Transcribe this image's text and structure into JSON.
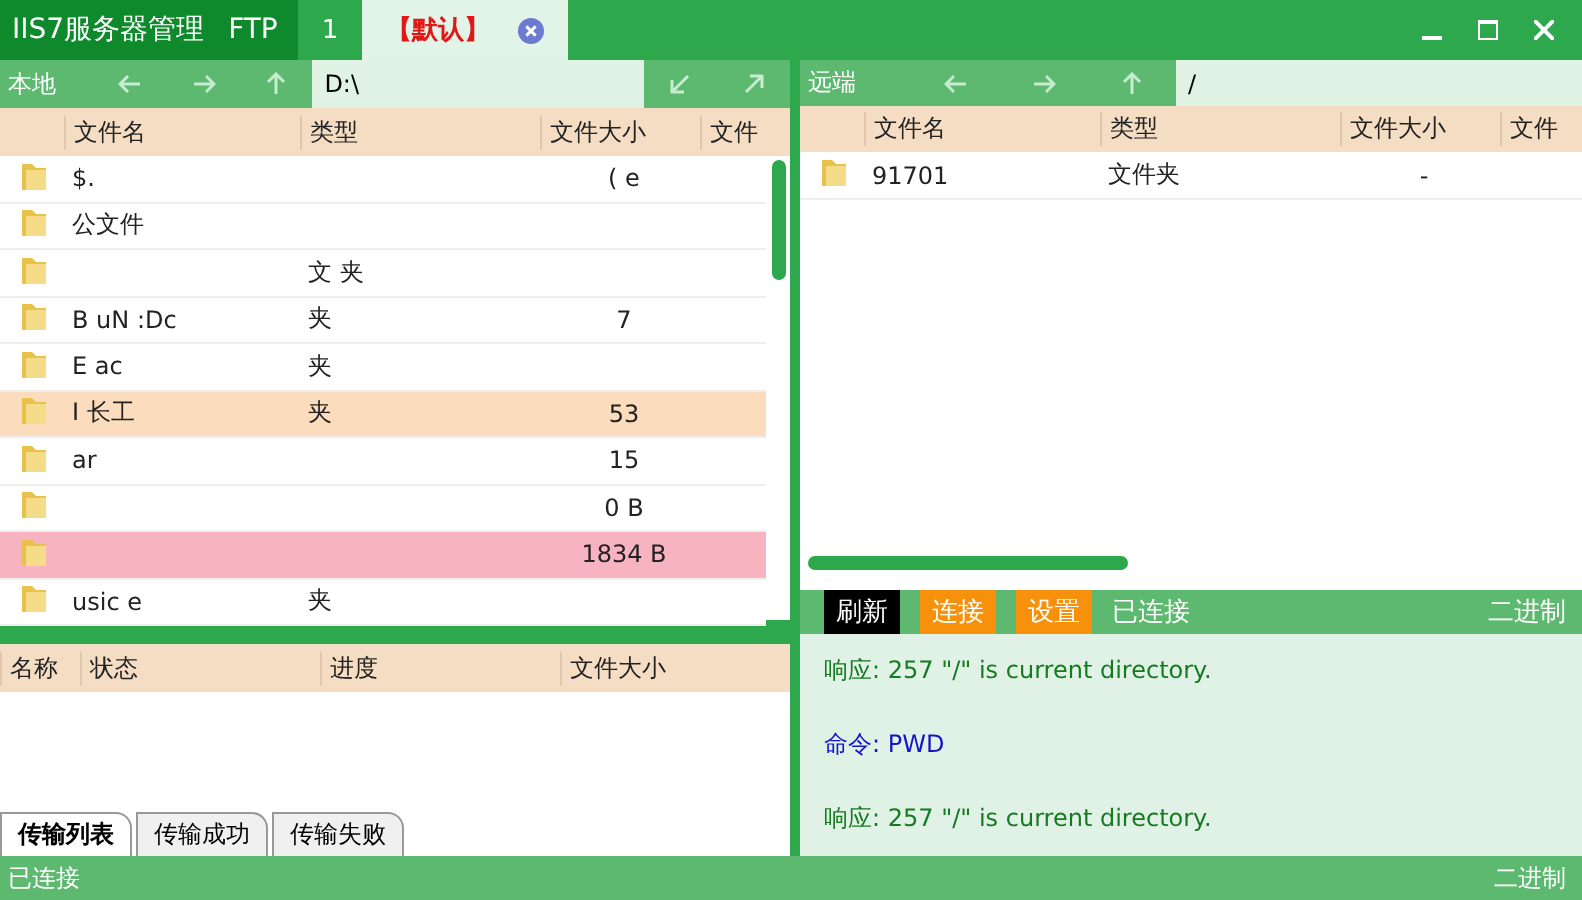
{
  "title_bar": {
    "app_title": "IIS7服务器管理",
    "section": "FTP",
    "tabs": [
      {
        "label": "1",
        "selected": false
      },
      {
        "label": "【默认】",
        "selected": true,
        "closable": true
      }
    ]
  },
  "local": {
    "label": "本地",
    "path": "D:\\",
    "columns": [
      "文件名",
      "类型",
      "文件大小",
      "文件"
    ],
    "rows": [
      {
        "name": "$.",
        "type": "",
        "size": "( e"
      },
      {
        "name": "公文件",
        "type": "",
        "size": ""
      },
      {
        "name": "",
        "type": "文 夹",
        "size": ""
      },
      {
        "name": "B uN :Dc",
        "type": "夹",
        "size": "7"
      },
      {
        "name": "E ac",
        "type": "夹",
        "size": ""
      },
      {
        "name": "I 长工",
        "type": "夹",
        "size": "53",
        "color": "#fbdcbc"
      },
      {
        "name": "ar",
        "type": "",
        "size": "15"
      },
      {
        "name": "",
        "type": "",
        "size": "0 B"
      },
      {
        "name": "",
        "type": "",
        "size": "1834 B",
        "color": "#f8b3c1"
      },
      {
        "name": "usic e",
        "type": "夹",
        "size": ""
      }
    ]
  },
  "remote": {
    "label": "远端",
    "path": "/",
    "columns": [
      "文件名",
      "类型",
      "文件大小",
      "文件"
    ],
    "rows": [
      {
        "name": "91701",
        "type": "文件夹",
        "size": "-"
      }
    ],
    "toolbar": [
      {
        "label": "刷新",
        "kind": "dark"
      },
      {
        "label": "连接",
        "kind": "orange"
      },
      {
        "label": "设置",
        "kind": "orange"
      }
    ],
    "status": "已连接",
    "mode": "二进制"
  },
  "transfer": {
    "columns": [
      "名称",
      "状态",
      "进度",
      "文件大小"
    ],
    "tabs": [
      {
        "label": "传输列表",
        "selected": true
      },
      {
        "label": "传输成功",
        "selected": false
      },
      {
        "label": "传输失败",
        "selected": false
      }
    ]
  },
  "log": [
    {
      "kind": "response",
      "text": "响应: 257 \"/\" is current directory."
    },
    {
      "kind": "command",
      "text": "命令:  PWD"
    },
    {
      "kind": "response",
      "text": "响应: 257 \"/\" is current directory."
    }
  ],
  "status_bar": {
    "status": "已连接",
    "mode": "二进制"
  }
}
